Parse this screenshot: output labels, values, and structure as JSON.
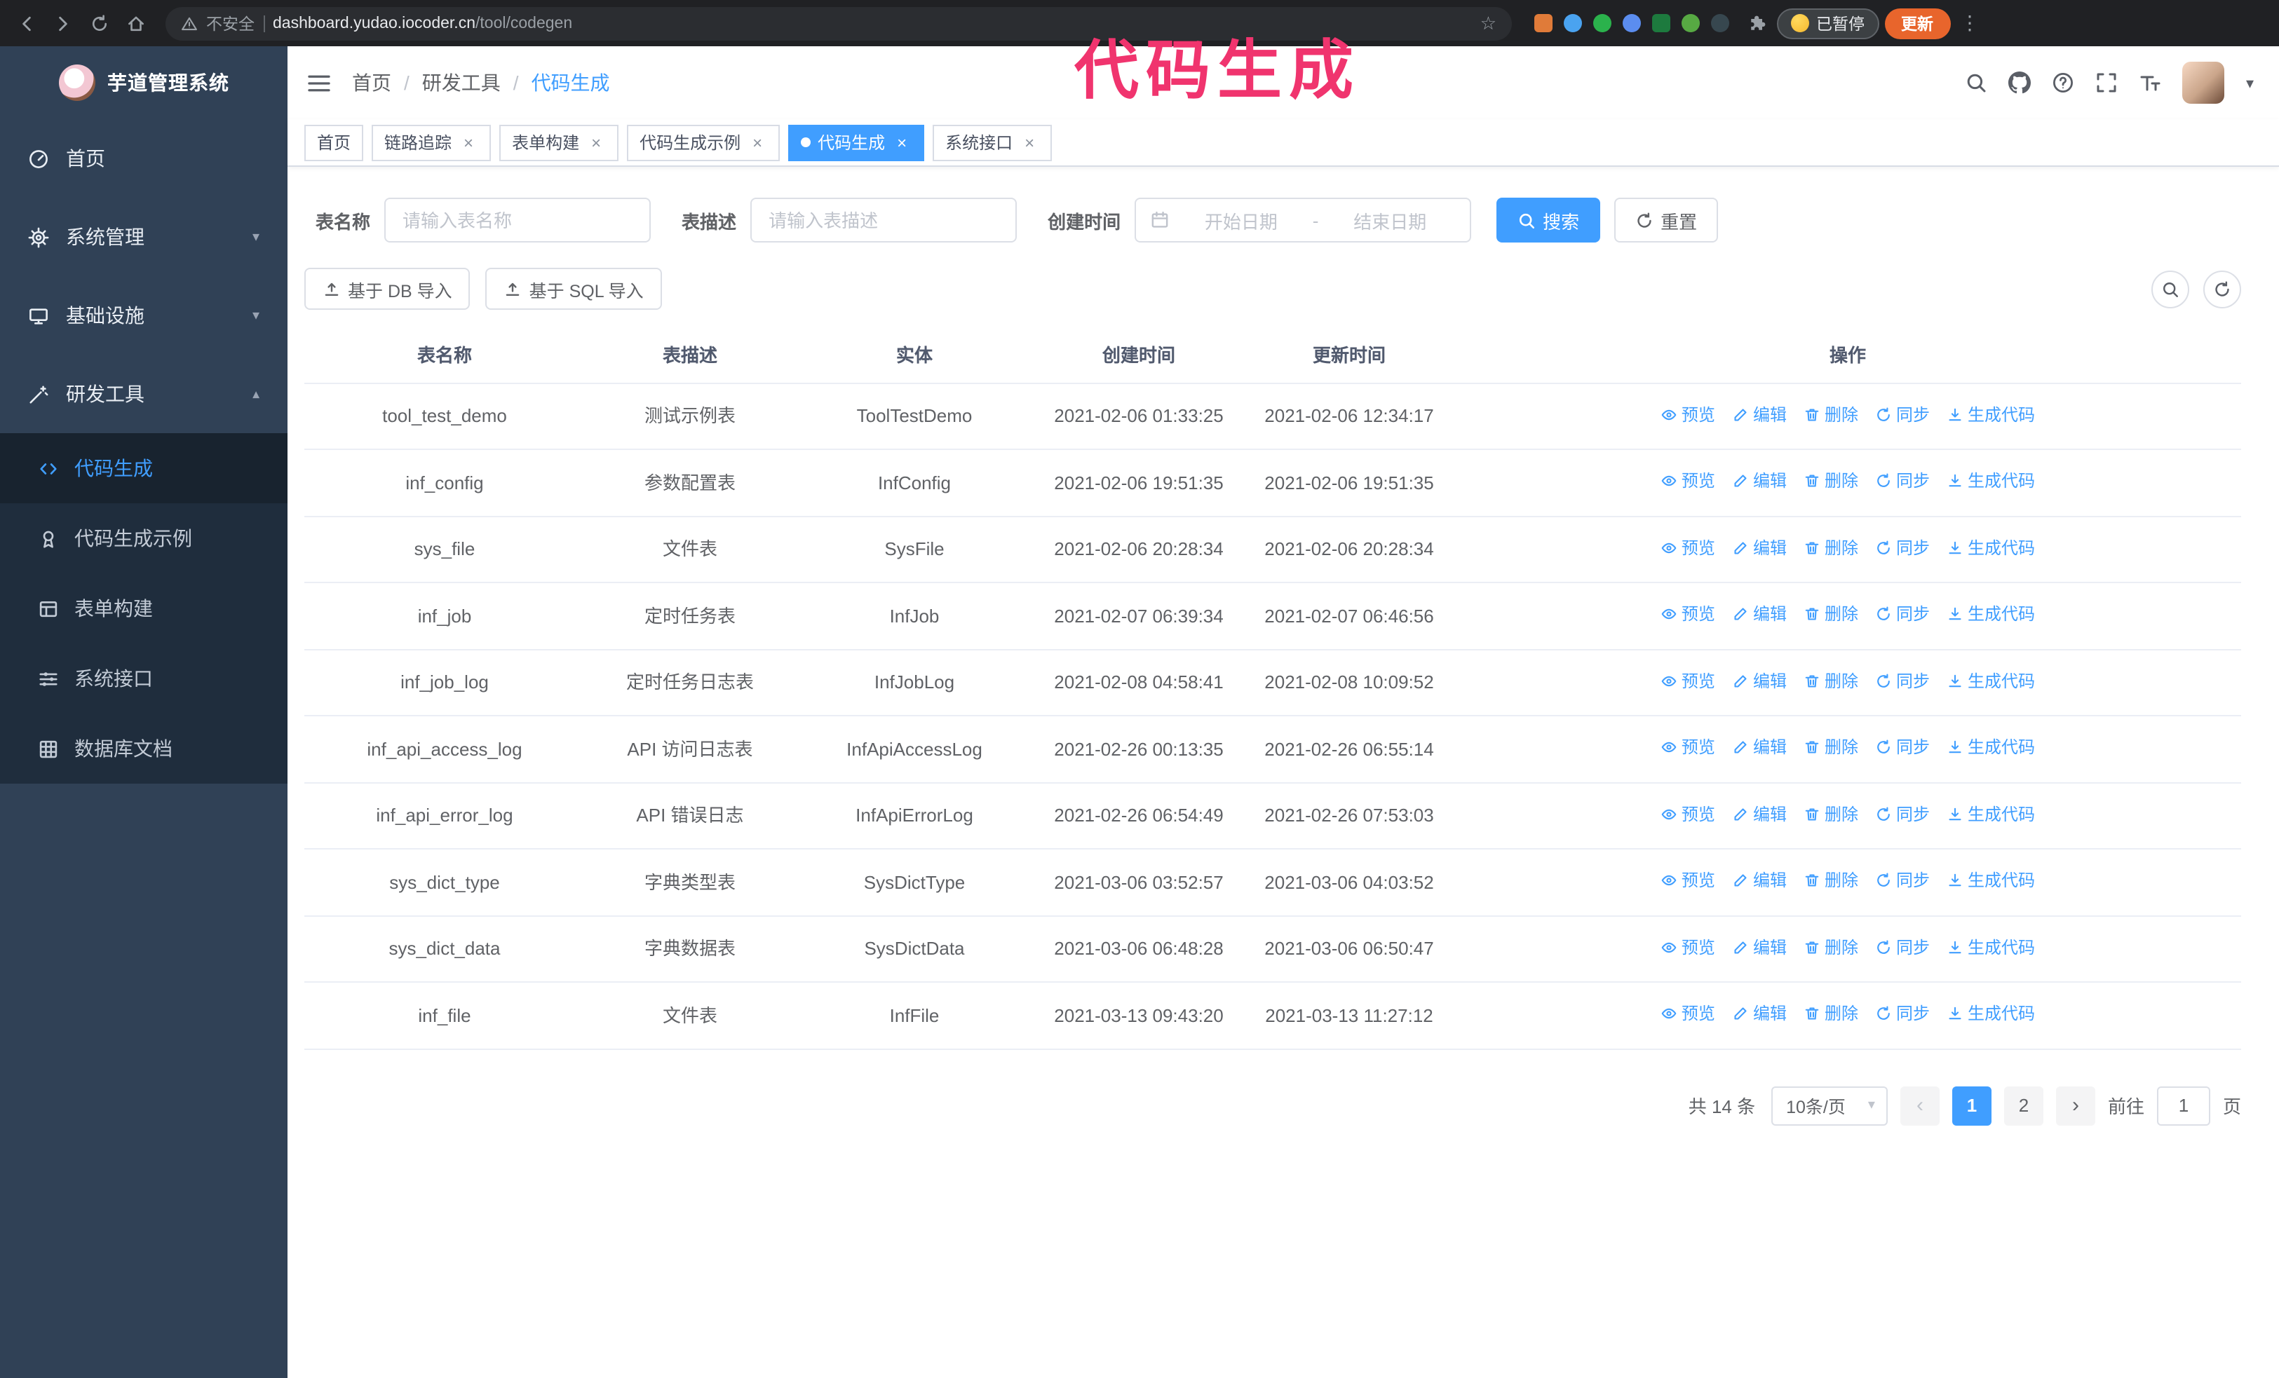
{
  "colors": {
    "accent": "#409eff",
    "annotation_pink": "#f0346e",
    "sidebar_bg": "#304156",
    "submenu_bg": "#1f2d3d",
    "chrome_bg": "#202124",
    "update_button_bg": "#e8652c"
  },
  "browser": {
    "security_label": "不安全",
    "url_host": "dashboard.yudao.iocoder.cn",
    "url_path": "/tool/codegen",
    "paused_badge": "已暂停",
    "update_button": "更新",
    "extensions": [
      {
        "key": "orange",
        "color": "#e07b39",
        "shape": "square"
      },
      {
        "key": "water-drop",
        "color": "#4aa3f0",
        "shape": "circle"
      },
      {
        "key": "green-check",
        "color": "#2bb24c",
        "shape": "circle"
      },
      {
        "key": "people",
        "color": "#5b8def",
        "shape": "circle"
      },
      {
        "key": "translate",
        "color": "#1d7a3e",
        "shape": "square"
      },
      {
        "key": "leaf",
        "color": "#57a943",
        "shape": "circle"
      },
      {
        "key": "pawn",
        "color": "#37474f",
        "shape": "circle"
      }
    ]
  },
  "annotation": {
    "text": "代码生成"
  },
  "sidebar": {
    "logo_title": "芋道管理系统",
    "menu": [
      {
        "key": "home",
        "label": "首页",
        "icon": "home-icon"
      },
      {
        "key": "system",
        "label": "系统管理",
        "icon": "gear-icon",
        "chevron": "down"
      },
      {
        "key": "infra",
        "label": "基础设施",
        "icon": "infra-icon",
        "chevron": "down"
      },
      {
        "key": "devtools",
        "label": "研发工具",
        "icon": "tools-icon",
        "chevron": "up",
        "expanded": true
      }
    ],
    "submenu": [
      {
        "key": "codegen",
        "label": "代码生成",
        "icon": "code-icon",
        "active": true
      },
      {
        "key": "codegen-example",
        "label": "代码生成示例",
        "icon": "medal-icon"
      },
      {
        "key": "form-builder",
        "label": "表单构建",
        "icon": "form-icon"
      },
      {
        "key": "system-api",
        "label": "系统接口",
        "icon": "sliders-icon"
      },
      {
        "key": "db-doc",
        "label": "数据库文档",
        "icon": "grid-icon"
      }
    ]
  },
  "header": {
    "breadcrumb": [
      {
        "key": "home",
        "label": "首页"
      },
      {
        "key": "devtools",
        "label": "研发工具"
      },
      {
        "key": "codegen",
        "label": "代码生成",
        "active": true
      }
    ]
  },
  "tabs": [
    {
      "key": "home",
      "label": "首页",
      "closable": false,
      "active": false
    },
    {
      "key": "tracer",
      "label": "链路追踪",
      "closable": true,
      "active": false
    },
    {
      "key": "form-builder",
      "label": "表单构建",
      "closable": true,
      "active": false
    },
    {
      "key": "codegen-example",
      "label": "代码生成示例",
      "closable": true,
      "active": false
    },
    {
      "key": "codegen",
      "label": "代码生成",
      "closable": true,
      "active": true
    },
    {
      "key": "system-api",
      "label": "系统接口",
      "closable": true,
      "active": false
    }
  ],
  "filters": {
    "table_name_label": "表名称",
    "table_name_placeholder": "请输入表名称",
    "table_desc_label": "表描述",
    "table_desc_placeholder": "请输入表描述",
    "create_time_label": "创建时间",
    "date_start_placeholder": "开始日期",
    "date_separator": "-",
    "date_end_placeholder": "结束日期",
    "search_button": "搜索",
    "reset_button": "重置"
  },
  "toolbar": {
    "import_db_button": "基于 DB 导入",
    "import_sql_button": "基于 SQL 导入"
  },
  "table": {
    "columns": [
      "表名称",
      "表描述",
      "实体",
      "创建时间",
      "更新时间",
      "操作"
    ],
    "actions": [
      {
        "key": "preview",
        "label": "预览",
        "icon": "eye-icon"
      },
      {
        "key": "edit",
        "label": "编辑",
        "icon": "edit-icon"
      },
      {
        "key": "delete",
        "label": "删除",
        "icon": "trash-icon"
      },
      {
        "key": "sync",
        "label": "同步",
        "icon": "sync-icon"
      },
      {
        "key": "generate",
        "label": "生成代码",
        "icon": "download-icon"
      }
    ],
    "rows": [
      {
        "name": "tool_test_demo",
        "desc": "测试示例表",
        "entity": "ToolTestDemo",
        "create_time": "2021-02-06 01:33:25",
        "update_time": "2021-02-06 12:34:17"
      },
      {
        "name": "inf_config",
        "desc": "参数配置表",
        "entity": "InfConfig",
        "create_time": "2021-02-06 19:51:35",
        "update_time": "2021-02-06 19:51:35"
      },
      {
        "name": "sys_file",
        "desc": "文件表",
        "entity": "SysFile",
        "create_time": "2021-02-06 20:28:34",
        "update_time": "2021-02-06 20:28:34"
      },
      {
        "name": "inf_job",
        "desc": "定时任务表",
        "entity": "InfJob",
        "create_time": "2021-02-07 06:39:34",
        "update_time": "2021-02-07 06:46:56"
      },
      {
        "name": "inf_job_log",
        "desc": "定时任务日志表",
        "entity": "InfJobLog",
        "create_time": "2021-02-08 04:58:41",
        "update_time": "2021-02-08 10:09:52"
      },
      {
        "name": "inf_api_access_log",
        "desc": "API 访问日志表",
        "entity": "InfApiAccessLog",
        "create_time": "2021-02-26 00:13:35",
        "update_time": "2021-02-26 06:55:14"
      },
      {
        "name": "inf_api_error_log",
        "desc": "API 错误日志",
        "entity": "InfApiErrorLog",
        "create_time": "2021-02-26 06:54:49",
        "update_time": "2021-02-26 07:53:03"
      },
      {
        "name": "sys_dict_type",
        "desc": "字典类型表",
        "entity": "SysDictType",
        "create_time": "2021-03-06 03:52:57",
        "update_time": "2021-03-06 04:03:52"
      },
      {
        "name": "sys_dict_data",
        "desc": "字典数据表",
        "entity": "SysDictData",
        "create_time": "2021-03-06 06:48:28",
        "update_time": "2021-03-06 06:50:47"
      },
      {
        "name": "inf_file",
        "desc": "文件表",
        "entity": "InfFile",
        "create_time": "2021-03-13 09:43:20",
        "update_time": "2021-03-13 11:27:12"
      }
    ]
  },
  "pagination": {
    "total_text": "共 14 条",
    "page_size_text": "10条/页",
    "pages": [
      "1",
      "2"
    ],
    "active_page": "1",
    "goto_prefix": "前往",
    "goto_value": "1",
    "goto_suffix": "页"
  }
}
